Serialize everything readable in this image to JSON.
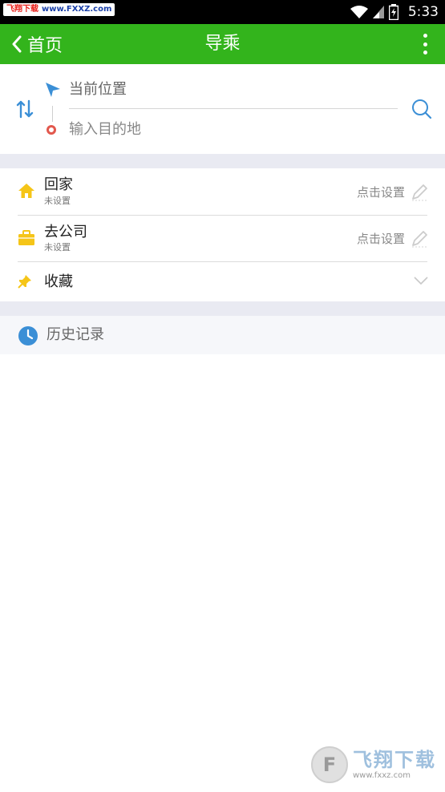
{
  "status_bar": {
    "watermark_left": "飞翔下载",
    "watermark_url": "www.FXXZ.com",
    "time": "5:33"
  },
  "header": {
    "back_label": "首页",
    "title": "导乘"
  },
  "route": {
    "origin": "当前位置",
    "destination_placeholder": "输入目的地"
  },
  "places": [
    {
      "name": "回家",
      "status": "未设置",
      "action": "点击设置"
    },
    {
      "name": "去公司",
      "status": "未设置",
      "action": "点击设置"
    },
    {
      "name": "收藏"
    }
  ],
  "history": {
    "label": "历史记录"
  },
  "watermark": {
    "brand": "飞翔下载",
    "url": "www.fxxz.com"
  },
  "colors": {
    "appbar_green": "#33b41c",
    "accent_blue": "#3b8fd6",
    "home_yellow": "#f5c518"
  }
}
